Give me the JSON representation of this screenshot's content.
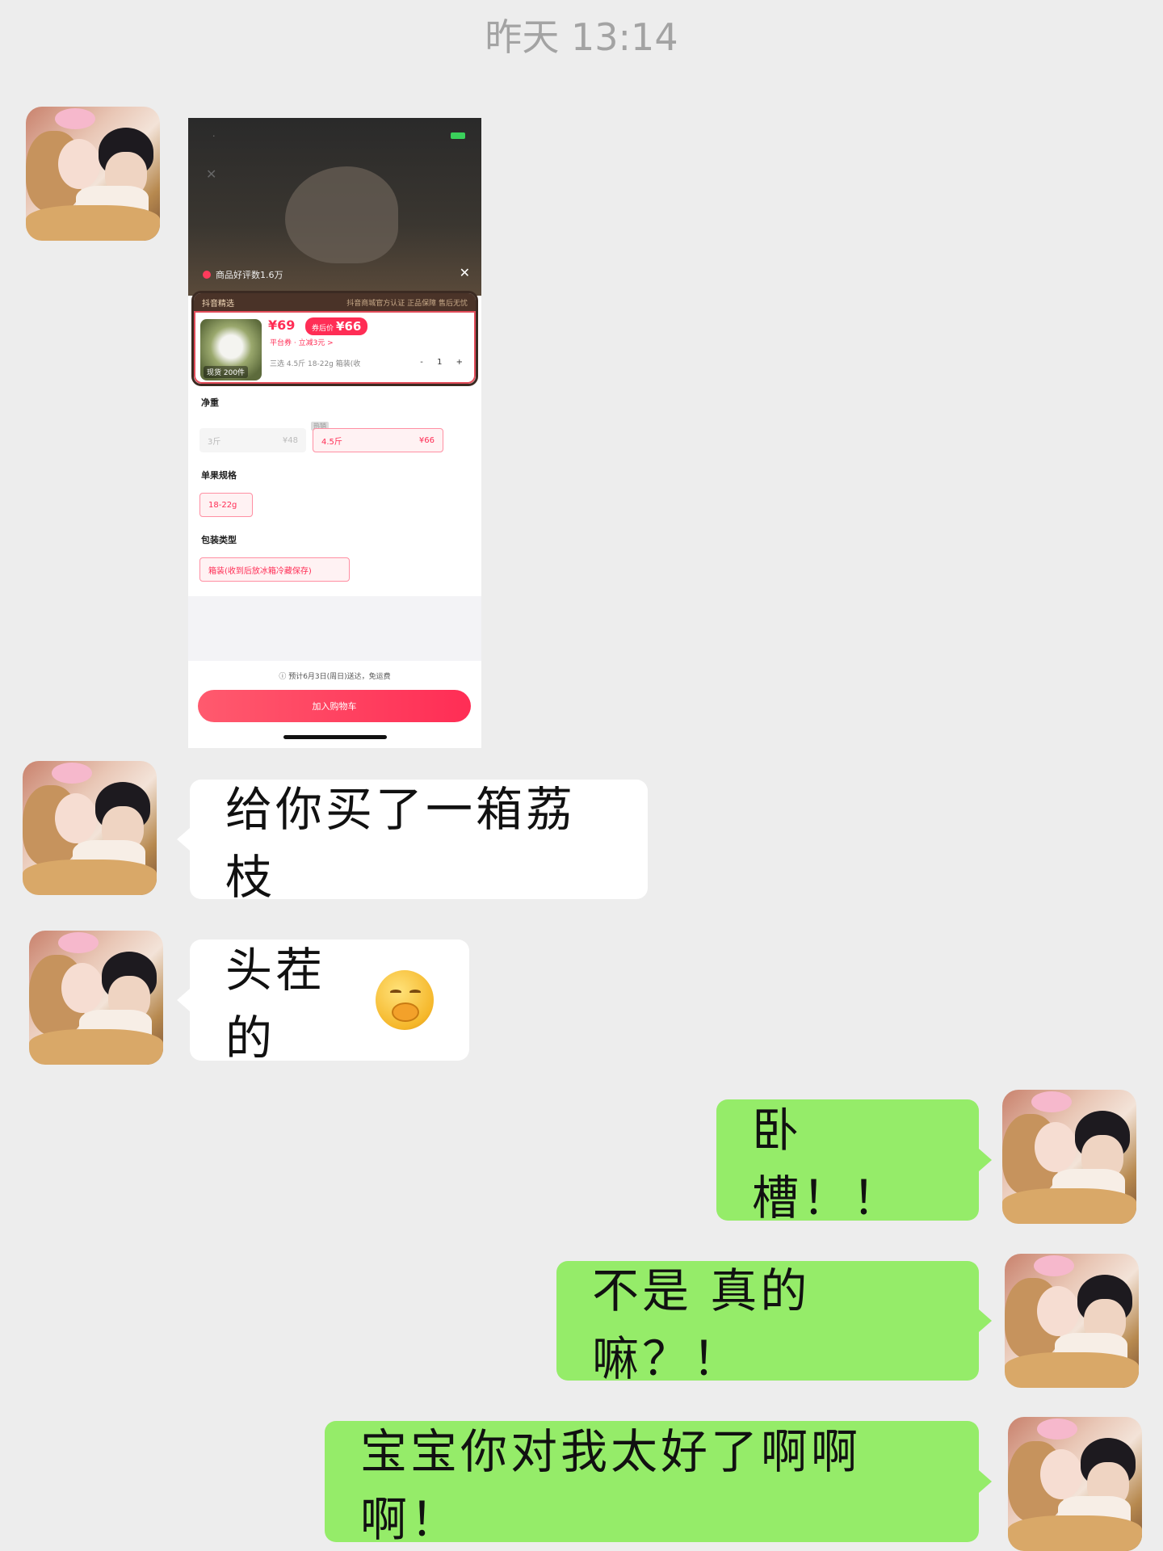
{
  "timestamp": "昨天 13:14",
  "product_screenshot": {
    "rating_text": "商品好评数1.6万",
    "card_header_left": "抖音精选",
    "card_header_right": "抖音商城官方认证  正品保障  售后无忧",
    "thumb_label": "现货 200件",
    "price": "¥69",
    "coupon_prefix": "券后价",
    "coupon_price": "¥66",
    "subsidy": "平台券 · 立减3元 >",
    "spec_summary": "三选 4.5斤 18-22g 箱装(收",
    "qty": "- 1 +",
    "section_weight": "净重",
    "weight_options": [
      {
        "label": "3斤",
        "price": "¥48"
      },
      {
        "label": "4.5斤",
        "price": "¥66"
      }
    ],
    "weight_tag": "热销",
    "section_size": "单果规格",
    "size_option": "18-22g",
    "section_pack": "包装类型",
    "pack_option": "箱装(收到后放冰箱冷藏保存)",
    "delivery": "ⓘ  预计6月3日(周日)送达，免运费",
    "cart_button": "加入购物车"
  },
  "messages": [
    {
      "side": "in",
      "text": "给你买了一箱荔枝"
    },
    {
      "side": "in",
      "text": "头茬的",
      "emoji": "thinking-hand-over-mouth-emoji"
    },
    {
      "side": "out",
      "text": "卧槽！！"
    },
    {
      "side": "out",
      "text": "不是 真的嘛？！"
    },
    {
      "side": "out",
      "text": "宝宝你对我太好了啊啊啊！"
    }
  ],
  "colors": {
    "background": "#ededed",
    "incoming_bubble": "#ffffff",
    "outgoing_bubble": "#95ec69",
    "accent_red": "#ff2d55"
  }
}
